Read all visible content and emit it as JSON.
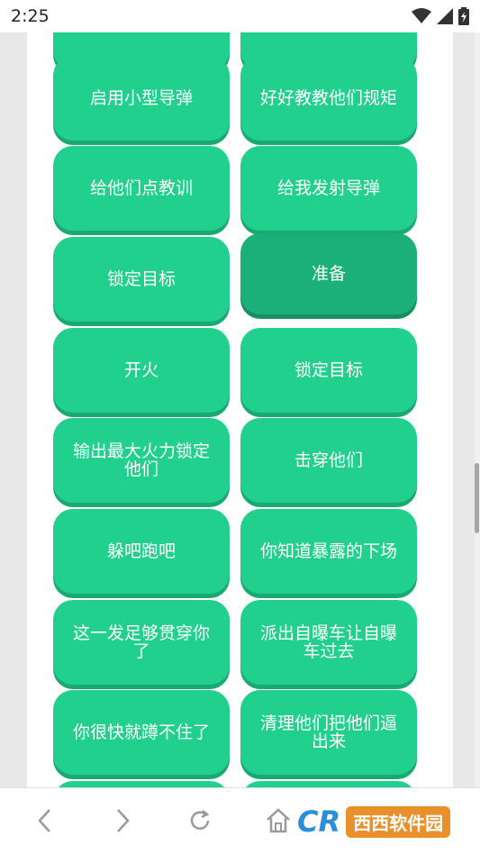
{
  "status": {
    "time": "2:25"
  },
  "buttons": {
    "r0c0": "",
    "r0c1": "",
    "r1c0": "启用小型导弹",
    "r1c1": "好好教教他们规矩",
    "r2c0": "给他们点教训",
    "r2c1": "给我发射导弹",
    "r3c0": "锁定目标",
    "r3c1": "准备",
    "r4c0": "开火",
    "r4c1": "锁定目标",
    "r5c0": "输出最大火力锁定他们",
    "r5c1": "击穿他们",
    "r6c0": "躲吧跑吧",
    "r6c1": "你知道暴露的下场",
    "r7c0": "这一发足够贯穿你了",
    "r7c1": "派出自曝车让自曝车过去",
    "r8c0": "你很快就蹲不住了",
    "r8c1": "清理他们把他们逼出来",
    "r9c0": "",
    "r9c1": ""
  },
  "colors": {
    "button": "#22d08e",
    "button_active": "#1bb07a",
    "button_shadow": "#1aa874"
  },
  "icons": {
    "wifi": "wifi-icon",
    "signal": "signal-icon",
    "battery": "battery-icon",
    "back": "chevron-left-icon",
    "forward": "chevron-right-icon",
    "reload": "reload-icon",
    "home": "home-icon"
  },
  "watermark": {
    "logo": "CR",
    "text": "西西软件园"
  }
}
